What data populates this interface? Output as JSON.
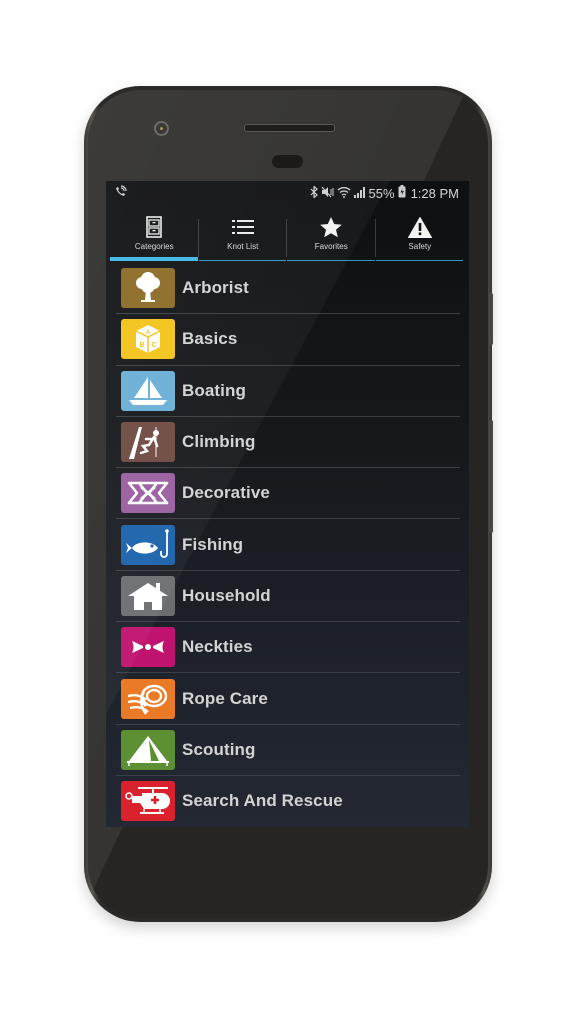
{
  "status_bar": {
    "left_icon": "wifi-calling-icon",
    "icons": [
      "bluetooth-icon",
      "mute-icon",
      "wifi-icon",
      "signal-icon"
    ],
    "battery": "55%",
    "battery_icon": "battery-charging-icon",
    "time": "1:28 PM"
  },
  "tabs": [
    {
      "label": "Categories",
      "icon": "file-cabinet-icon",
      "active": true
    },
    {
      "label": "Knot List",
      "icon": "list-icon",
      "active": false
    },
    {
      "label": "Favorites",
      "icon": "star-icon",
      "active": false
    },
    {
      "label": "Safety",
      "icon": "warning-icon",
      "active": false
    }
  ],
  "categories": [
    {
      "label": "Arborist",
      "icon": "tree-icon",
      "color": "#8b6a25"
    },
    {
      "label": "Basics",
      "icon": "abc-block-icon",
      "color": "#f2c318"
    },
    {
      "label": "Boating",
      "icon": "sailboat-icon",
      "color": "#6aaed6"
    },
    {
      "label": "Climbing",
      "icon": "climber-icon",
      "color": "#6e4a40"
    },
    {
      "label": "Decorative",
      "icon": "celtic-knot-icon",
      "color": "#9a5ea0"
    },
    {
      "label": "Fishing",
      "icon": "fish-hook-icon",
      "color": "#1a62ab"
    },
    {
      "label": "Household",
      "icon": "house-icon",
      "color": "#6b6d71"
    },
    {
      "label": "Neckties",
      "icon": "bowtie-icon",
      "color": "#c0136f"
    },
    {
      "label": "Rope Care",
      "icon": "rope-coil-icon",
      "color": "#ea7a25"
    },
    {
      "label": "Scouting",
      "icon": "tent-icon",
      "color": "#5d8f33"
    },
    {
      "label": "Search And Rescue",
      "icon": "helicopter-icon",
      "color": "#d9222e"
    }
  ]
}
